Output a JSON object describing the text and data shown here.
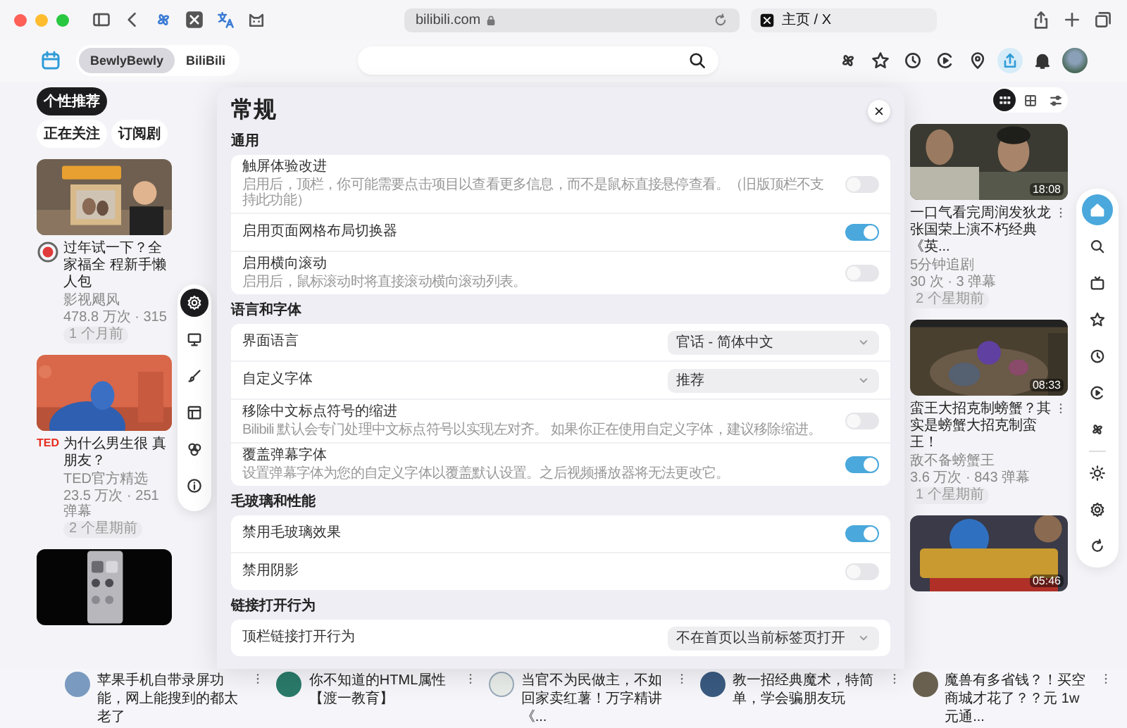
{
  "browser": {
    "address": "bilibili.com",
    "tab": "主页 / X"
  },
  "header": {
    "tabs": [
      {
        "label": "BewlyBewly",
        "selected": true
      },
      {
        "label": "BiliBili",
        "selected": false
      }
    ],
    "upload_active": true
  },
  "feed_tabs": [
    {
      "label": "个性推荐",
      "selected": true
    },
    {
      "label": "正在关注",
      "selected": false
    },
    {
      "label": "订阅剧",
      "selected": false
    }
  ],
  "left_cards": [
    {
      "avatar": {
        "kind": "logo"
      },
      "title": "过年试一下？全家福全 程新手懒人包",
      "channel": "影视飓风",
      "stats": "478.8 万次 · 315",
      "date": "1 个月前"
    },
    {
      "avatar": {
        "kind": "text",
        "text": "TED"
      },
      "title": "为什么男生很 真朋友？",
      "channel": "TED官方精选",
      "stats": "23.5 万次 · 251 弹幕",
      "date": "2 个星期前"
    },
    {
      "kind": "picture"
    }
  ],
  "side_menu": [
    {
      "selected": true
    },
    {
      "selected": false
    },
    {
      "selected": false
    },
    {
      "selected": false
    },
    {
      "selected": false
    },
    {
      "selected": false
    }
  ],
  "view_modes": [
    {
      "selected": true
    },
    {
      "selected": false
    },
    {
      "selected": false
    }
  ],
  "right_cards": [
    {
      "duration": "18:08",
      "title": "一口气看完周润发狄龙张国荣上演不朽经典《英...",
      "channel": "5分钟追剧",
      "stats": "30 次 · 3 弹幕",
      "date": "2 个星期前"
    },
    {
      "duration": "08:33",
      "title": "蛮王大招克制螃蟹？其实是螃蟹大招克制蛮王！",
      "channel": "敌不备螃蟹王",
      "stats": "3.6 万次 · 843 弹幕",
      "date": "1 个星期前"
    },
    {
      "duration": "05:46"
    }
  ],
  "dock": [
    {
      "selected": true
    },
    {
      "selected": false
    },
    {
      "selected": false
    },
    {
      "selected": false
    },
    {
      "selected": false
    },
    {
      "selected": false
    },
    {
      "selected": false
    },
    {
      "selected": false
    },
    {
      "selected": false
    },
    {
      "selected": false
    }
  ],
  "settings": {
    "title": "常规",
    "sections": [
      {
        "heading": "通用",
        "rows": [
          {
            "kind": "toggle",
            "label": "触屏体验改进",
            "description": "启用后，顶栏，你可能需要点击项目以查看更多信息，而不是鼠标直接悬停查看。（旧版顶栏不支持此功能）",
            "on": false
          },
          {
            "kind": "toggle",
            "label": "启用页面网格布局切换器",
            "on": true
          },
          {
            "kind": "toggle",
            "label": "启用横向滚动",
            "description": "启用后，鼠标滚动时将直接滚动横向滚动列表。",
            "on": false
          }
        ]
      },
      {
        "heading": "语言和字体",
        "rows": [
          {
            "kind": "select",
            "label": "界面语言",
            "value": "官话 - 简体中文"
          },
          {
            "kind": "select",
            "label": "自定义字体",
            "value": "推荐"
          },
          {
            "kind": "toggle",
            "label": "移除中文标点符号的缩进",
            "description": "Bilibili 默认会专门处理中文标点符号以实现左对齐。 如果你正在使用自定义字体，建议移除缩进。",
            "on": false
          },
          {
            "kind": "toggle",
            "label": "覆盖弹幕字体",
            "description": "设置弹幕字体为您的自定义字体以覆盖默认设置。之后视频播放器将无法更改它。",
            "on": true
          }
        ]
      },
      {
        "heading": "毛玻璃和性能",
        "rows": [
          {
            "kind": "toggle",
            "label": "禁用毛玻璃效果",
            "on": true
          },
          {
            "kind": "toggle",
            "label": "禁用阴影",
            "on": false
          }
        ]
      },
      {
        "heading": "链接打开行为",
        "rows": [
          {
            "kind": "select",
            "label": "顶栏链接打开行为",
            "value": "不在首页以当前标签页打开"
          }
        ]
      }
    ]
  },
  "bottom_strip": [
    {
      "title": "苹果手机自带录屏功能，网上能搜到的都太老了"
    },
    {
      "title": "你不知道的HTML属性【渡一教育】"
    },
    {
      "title": "当官不为民做主，不如回家卖红薯！万字精讲《..."
    },
    {
      "title": "教一招经典魔术，特简单，学会骗朋友玩"
    },
    {
      "title": "魔兽有多省钱？！买空商城才花了？？元 1w元通..."
    }
  ]
}
